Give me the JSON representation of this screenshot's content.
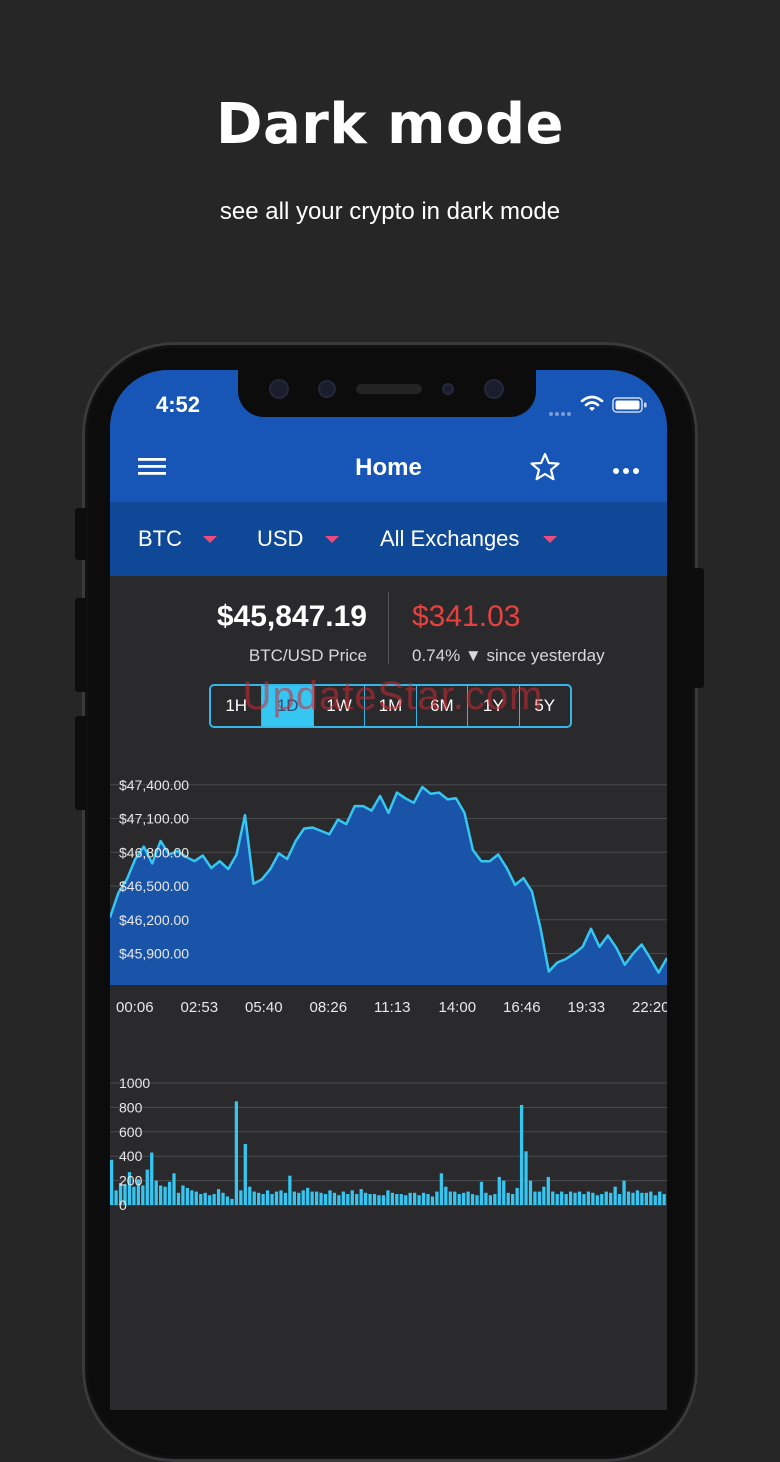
{
  "headline": "Dark mode",
  "subline": "see all your crypto in dark mode",
  "status": {
    "time": "4:52"
  },
  "nav": {
    "title": "Home",
    "menu_icon": "hamburger-icon",
    "favorite_icon": "star-icon",
    "more_icon": "more-icon"
  },
  "filters": {
    "coin": "BTC",
    "currency": "USD",
    "exchange": "All Exchanges"
  },
  "price": {
    "value": "$45,847.19",
    "label": "BTC/USD Price"
  },
  "change": {
    "value": "$341.03",
    "label": "0.74% ▼ since yesterday",
    "color": "#e5423f"
  },
  "ranges": [
    "1H",
    "1D",
    "1W",
    "1M",
    "6M",
    "1Y",
    "5Y"
  ],
  "active_range": "1D",
  "watermark": "UpdateStar.com",
  "colors": {
    "primary": "#1756b6",
    "secondary": "#0f4897",
    "accent": "#35c6f1",
    "caret": "#ec4b7c"
  },
  "chart_data": [
    {
      "type": "area",
      "y_ticks": [
        "$47,400.00",
        "$47,100.00",
        "$46,800.00",
        "$46,500.00",
        "$46,200.00",
        "$45,900.00"
      ],
      "x_ticks": [
        "00:06",
        "02:53",
        "05:40",
        "08:26",
        "11:13",
        "14:00",
        "16:46",
        "19:33",
        "22:20"
      ],
      "ylim": [
        45620,
        47620
      ],
      "values": [
        46220,
        46440,
        46560,
        46740,
        46850,
        46700,
        46900,
        46780,
        46810,
        46760,
        46720,
        46770,
        46660,
        46720,
        46650,
        46780,
        47130,
        46520,
        46560,
        46650,
        46790,
        46740,
        46900,
        47010,
        47020,
        46990,
        46960,
        47090,
        47050,
        47210,
        47210,
        47170,
        47300,
        47150,
        47330,
        47280,
        47240,
        47380,
        47320,
        47330,
        47270,
        47280,
        47150,
        46820,
        46720,
        46720,
        46780,
        46660,
        46510,
        46570,
        46450,
        46130,
        45740,
        45820,
        45850,
        45900,
        45960,
        46120,
        45960,
        46060,
        45950,
        45800,
        45900,
        45980,
        45860,
        45730,
        45860
      ]
    },
    {
      "type": "bar",
      "y_ticks": [
        "1000",
        "800",
        "600",
        "400",
        "200",
        "0"
      ],
      "ylim": [
        0,
        1000
      ],
      "values": [
        370,
        120,
        180,
        170,
        270,
        150,
        210,
        160,
        290,
        430,
        200,
        160,
        150,
        190,
        260,
        100,
        160,
        140,
        120,
        110,
        90,
        100,
        80,
        90,
        130,
        100,
        70,
        50,
        850,
        120,
        500,
        150,
        110,
        100,
        90,
        120,
        90,
        110,
        120,
        100,
        240,
        110,
        100,
        120,
        140,
        110,
        110,
        100,
        90,
        120,
        100,
        80,
        110,
        90,
        120,
        90,
        130,
        100,
        90,
        90,
        80,
        80,
        120,
        100,
        90,
        90,
        80,
        100,
        100,
        80,
        100,
        90,
        70,
        110,
        260,
        150,
        110,
        110,
        90,
        100,
        110,
        90,
        80,
        190,
        100,
        80,
        90,
        230,
        200,
        100,
        90,
        140,
        820,
        440,
        200,
        110,
        110,
        150,
        230,
        110,
        90,
        110,
        90,
        110,
        100,
        110,
        90,
        110,
        100,
        80,
        90,
        110,
        100,
        150,
        90,
        200,
        110,
        100,
        120,
        100,
        100,
        110,
        80,
        110,
        90
      ]
    }
  ]
}
